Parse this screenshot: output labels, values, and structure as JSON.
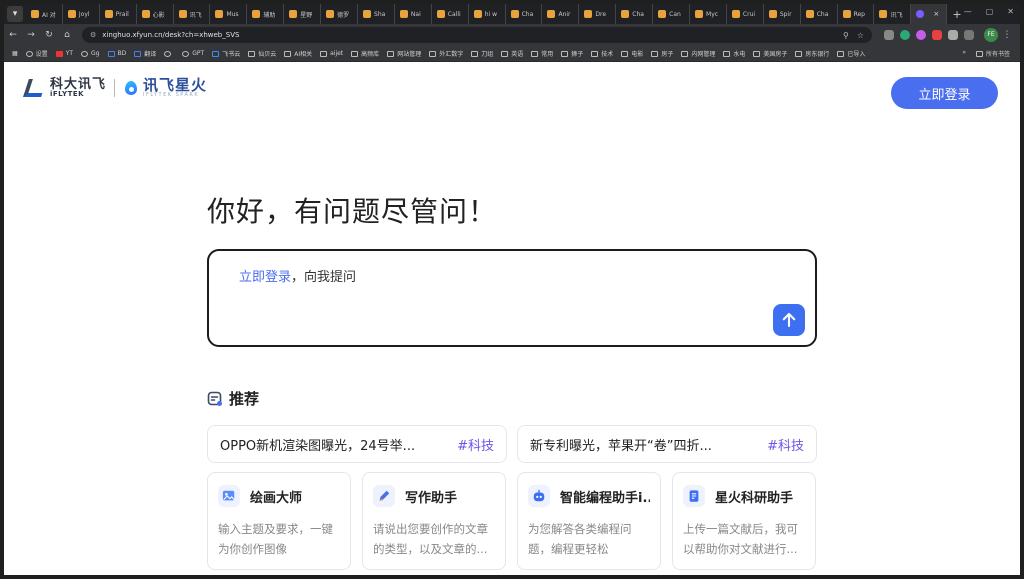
{
  "browser": {
    "tabs": [
      {
        "title": "AI 对"
      },
      {
        "title": "Joyl"
      },
      {
        "title": "Prail"
      },
      {
        "title": "心影"
      },
      {
        "title": "讯飞"
      },
      {
        "title": "Mus"
      },
      {
        "title": "辅助"
      },
      {
        "title": "星野"
      },
      {
        "title": "德罗"
      },
      {
        "title": "Sha"
      },
      {
        "title": "Nai"
      },
      {
        "title": "Calli"
      },
      {
        "title": "hi w"
      },
      {
        "title": "Cha"
      },
      {
        "title": "Anir"
      },
      {
        "title": "Dre"
      },
      {
        "title": "Cha"
      },
      {
        "title": "Can"
      },
      {
        "title": "Myc"
      },
      {
        "title": "Crui"
      },
      {
        "title": "Spir"
      },
      {
        "title": "Cha"
      },
      {
        "title": "Rep"
      },
      {
        "title": "讯飞"
      }
    ],
    "active_tab_close": "×",
    "new_tab": "+",
    "url": "xinghuo.xfyun.cn/desk?ch=xhweb_SVS",
    "profile": "FE",
    "bookmarks": [
      "设置",
      "YT",
      "Gg",
      "BD",
      "翻译",
      "",
      "GPT",
      "飞书云",
      "仙贝云",
      "AI相关",
      "aijet",
      "高频库",
      "网站管理",
      "外汇数字",
      "刀组",
      "英语",
      "常用",
      "狮子",
      "技术",
      "电影",
      "房子",
      "内网管理",
      "水电",
      "美国房子",
      "房东银行",
      "已导入"
    ],
    "bookmarks_more": "»",
    "bookmarks_all": "所有书签"
  },
  "header": {
    "brand_cn": "科大讯飞",
    "brand_en": "iFLYTEK",
    "product_cn": "讯飞星火",
    "product_en": "IFLYTEK SPARK",
    "login_label": "立即登录"
  },
  "main": {
    "greeting": "你好，有问题尽管问！",
    "prompt_link": "立即登录",
    "prompt_rest": "，向我提问",
    "recommend_title": "推荐",
    "news": [
      {
        "text": "OPPO新机渲染图曝光，24号举...",
        "tag": "#科技"
      },
      {
        "text": "新专利曝光，苹果开“卷”四折...",
        "tag": "#科技"
      }
    ],
    "cards": [
      {
        "name": "绘画大师",
        "desc": "输入主题及要求，一键为你创作图像",
        "icon": "paint-icon"
      },
      {
        "name": "写作助手",
        "desc": "请说出您要创作的文章的类型，以及文章的...",
        "icon": "pen-icon"
      },
      {
        "name": "智能编程助手i...",
        "desc": "为您解答各类编程问题，编程更轻松",
        "icon": "robot-icon"
      },
      {
        "name": "星火科研助手",
        "desc": "上传一篇文献后，我可以帮助你对文献进行...",
        "icon": "document-icon"
      }
    ]
  },
  "colors": {
    "accent": "#4a6ef0",
    "send": "#3d6ff1",
    "tag": "#6b55e8"
  }
}
